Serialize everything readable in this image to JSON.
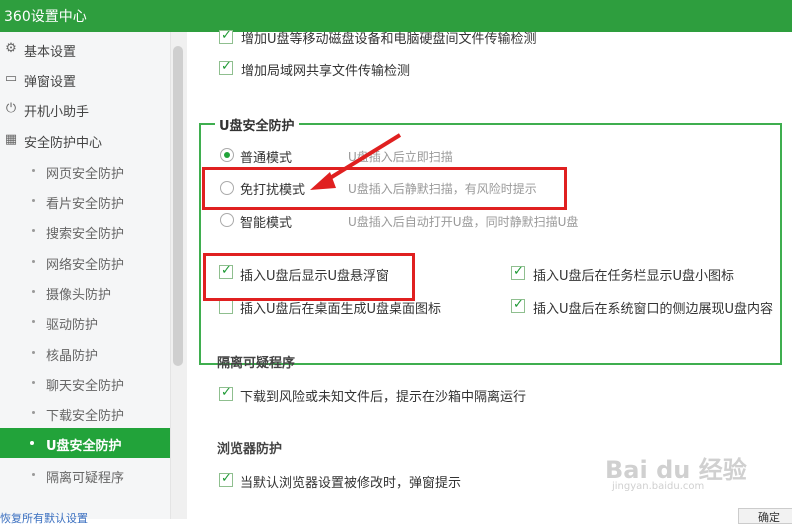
{
  "window": {
    "title": "360设置中心"
  },
  "sidebar": {
    "items": [
      {
        "label": "基本设置",
        "icon": "gear-icon"
      },
      {
        "label": "弹窗设置",
        "icon": "window-icon"
      },
      {
        "label": "开机小助手",
        "icon": "power-icon"
      },
      {
        "label": "安全防护中心",
        "icon": "grid-icon"
      }
    ],
    "subitems": [
      "网页安全防护",
      "看片安全防护",
      "搜索安全防护",
      "网络安全防护",
      "摄像头防护",
      "驱动防护",
      "核晶防护",
      "聊天安全防护",
      "下载安全防护",
      "U盘安全防护",
      "隔离可疑程序"
    ],
    "active_index": 9
  },
  "main": {
    "top_options": [
      {
        "label": "增加U盘等移动磁盘设备和电脑硬盘间文件传输检测",
        "checked": true
      },
      {
        "label": "增加局域网共享文件传输检测",
        "checked": true
      }
    ],
    "usb": {
      "title": "U盘安全防护",
      "modes": [
        {
          "label": "普通模式",
          "desc": "U盘插入后立即扫描",
          "selected": true
        },
        {
          "label": "免打扰模式",
          "desc": "U盘插入后静默扫描，有风险时提示",
          "selected": false
        },
        {
          "label": "智能模式",
          "desc": "U盘插入后自动打开U盘，同时静默扫描U盘",
          "selected": false
        }
      ],
      "options": [
        {
          "label": "插入U盘后显示U盘悬浮窗",
          "checked": true
        },
        {
          "label": "插入U盘后在任务栏显示U盘小图标",
          "checked": true
        },
        {
          "label": "插入U盘后在桌面生成U盘桌面图标",
          "checked": false
        },
        {
          "label": "插入U盘后在系统窗口的侧边展现U盘内容",
          "checked": true
        }
      ]
    },
    "quarantine": {
      "title": "隔离可疑程序",
      "option": "下载到风险或未知文件后，提示在沙箱中隔离运行",
      "checked": true
    },
    "browser": {
      "title": "浏览器防护",
      "option": "当默认浏览器设置被修改时，弹窗提示",
      "checked": true
    }
  },
  "footer": {
    "link": "恢复所有默认设置",
    "button": "确定"
  },
  "watermark": {
    "text": "Bai du 经验",
    "url": "jingyan.baidu.com"
  },
  "colors": {
    "titlebar": "#2e9e3e",
    "accent": "#22a33a",
    "highlight": "#e02020"
  }
}
